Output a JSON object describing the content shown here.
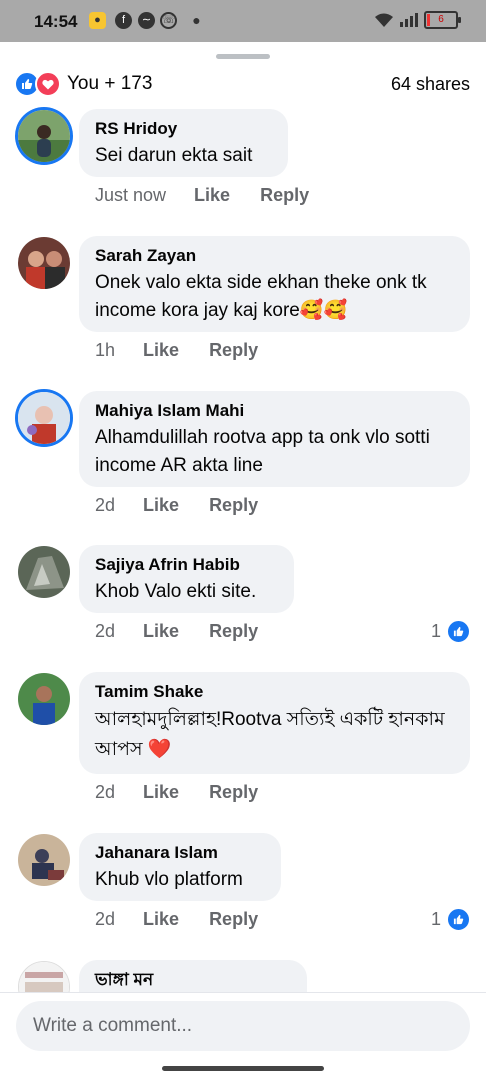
{
  "status_bar": {
    "time": "14:54",
    "battery": "6"
  },
  "reactions": {
    "summary": "You + 173",
    "shares": "64 shares"
  },
  "comments": [
    {
      "author": "RS Hridoy",
      "text": "Sei darun ekta sait",
      "time": "Just now",
      "like": "Like",
      "reply": "Reply",
      "likes": ""
    },
    {
      "author": "Sarah Zayan",
      "text": "Onek valo ekta side ekhan theke onk tk income kora jay kaj kore🥰🥰",
      "time": "1h",
      "like": "Like",
      "reply": "Reply",
      "likes": ""
    },
    {
      "author": "Mahiya Islam Mahi",
      "text": "Alhamdulillah rootva app ta onk vlo sotti income AR akta line",
      "time": "2d",
      "like": "Like",
      "reply": "Reply",
      "likes": ""
    },
    {
      "author": "Sajiya Afrin Habib",
      "text": "Khob Valo ekti site.",
      "time": "2d",
      "like": "Like",
      "reply": "Reply",
      "likes": "1"
    },
    {
      "author": "Tamim Shake",
      "text": "আলহামদুলিল্লাহ!Rootva সত্যিই একটি হানকাম আপস ❤️",
      "time": "2d",
      "like": "Like",
      "reply": "Reply",
      "likes": ""
    },
    {
      "author": "Jahanara Islam",
      "text": "Khub vlo platform",
      "time": "2d",
      "like": "Like",
      "reply": "Reply",
      "likes": "1"
    },
    {
      "author": "ভাঙ্গা মন",
      "text": "",
      "time": "",
      "like": "",
      "reply": "",
      "likes": ""
    }
  ],
  "composer": {
    "placeholder": "Write a comment..."
  },
  "colors": {
    "accent": "#1877f2",
    "love": "#f33e58",
    "bubble": "#f0f2f5",
    "meta": "#65676b"
  }
}
